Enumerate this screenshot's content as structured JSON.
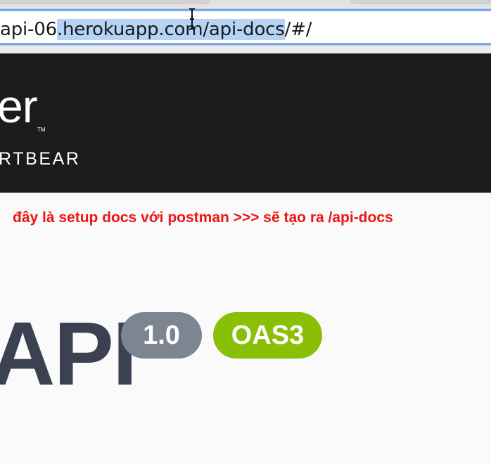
{
  "browser": {
    "url_prefix": "api-06",
    "url_selected": ".herokuapp.com/api-docs",
    "url_suffix": "/#/"
  },
  "swagger_header": {
    "brand_name": "er",
    "trademark": "TM",
    "sub_brand": "RTBEAR"
  },
  "annotation": {
    "text": "đây là setup docs với postman >>> sẽ tạo ra /api-docs",
    "color": "#ee1515"
  },
  "info": {
    "title": "API",
    "version_badge": "1.0",
    "spec_badge": "OAS3"
  },
  "colors": {
    "topbar": "#1b1b1b",
    "title": "#3b4151",
    "version_badge": "#7d8492",
    "oas_badge": "#89bf04",
    "selection": "#b5d3f5"
  }
}
